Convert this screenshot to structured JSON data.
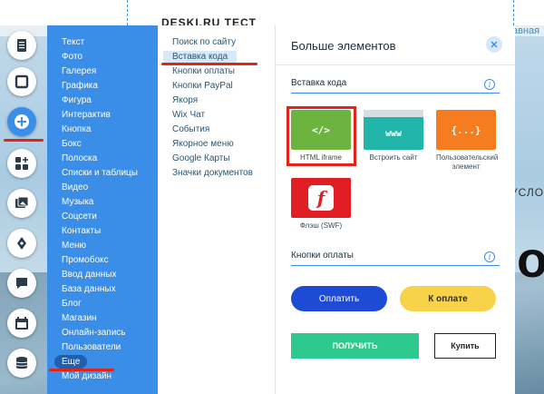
{
  "background": {
    "site_title": "DESKI.RU TECT",
    "link_fragment": "авная",
    "side_text": "УСЛО",
    "big_letter": "o"
  },
  "rail": {
    "items": [
      {
        "icon": "pages-icon"
      },
      {
        "icon": "background-icon"
      },
      {
        "icon": "add-icon"
      },
      {
        "icon": "apps-icon"
      },
      {
        "icon": "media-icon"
      },
      {
        "icon": "pen-icon"
      },
      {
        "icon": "chat-icon"
      },
      {
        "icon": "calendar-icon"
      },
      {
        "icon": "database-icon"
      }
    ]
  },
  "categories": {
    "items": [
      "Текст",
      "Фото",
      "Галерея",
      "Графика",
      "Фигура",
      "Интерактив",
      "Кнопка",
      "Бокс",
      "Полоска",
      "Списки и таблицы",
      "Видео",
      "Музыка",
      "Соцсети",
      "Контакты",
      "Меню",
      "Промобокс",
      "Ввод данных",
      "База данных",
      "Блог",
      "Магазин",
      "Онлайн-запись",
      "Пользователи",
      "Еще",
      "Мой дизайн"
    ],
    "selected": "Еще"
  },
  "submenu": {
    "items": [
      "Поиск по сайту",
      "Вставка кода",
      "Кнопки оплаты",
      "Кнопки PayPal",
      "Якоря",
      "Wix Чат",
      "События",
      "Якорное меню",
      "Google Карты",
      "Значки документов"
    ],
    "selected": "Вставка кода"
  },
  "panel": {
    "title": "Больше элементов",
    "section1": {
      "title": "Вставка кода",
      "tiles": [
        {
          "label": "HTML iframe",
          "glyph": "</>",
          "color": "#6db33f"
        },
        {
          "label": "Встроить сайт",
          "glyph": "www",
          "color": "#20b5a8"
        },
        {
          "label": "Пользовательский элемент",
          "glyph": "{...}",
          "color": "#f57c1f"
        },
        {
          "label": "Флэш (SWF)",
          "glyph": "f",
          "color": "#e01e24"
        }
      ]
    },
    "section2": {
      "title": "Кнопки оплаты",
      "pay_blue": "Оплатить",
      "pay_yellow": "К оплате",
      "buy_green": "ПОЛУЧИТЬ",
      "buy_white": "Купить"
    }
  },
  "colors": {
    "accent": "#3b8ee8",
    "highlight": "#e2231a",
    "pay_blue": "#1e4bd6",
    "pay_yellow": "#f8d34a",
    "buy_green": "#2ec98f"
  }
}
